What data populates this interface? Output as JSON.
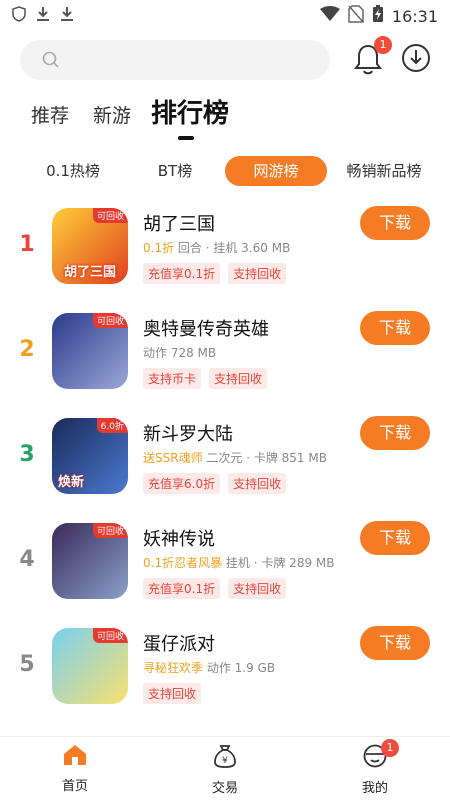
{
  "status_bar": {
    "time": "16:31"
  },
  "header": {
    "bell_badge": "1"
  },
  "main_tabs": [
    {
      "label": "推荐"
    },
    {
      "label": "新游"
    },
    {
      "label": "排行榜"
    }
  ],
  "chips": [
    {
      "label": "0.1热榜"
    },
    {
      "label": "BT榜"
    },
    {
      "label": "网游榜"
    },
    {
      "label": "畅销新品榜"
    }
  ],
  "games": [
    {
      "rank": "1",
      "rank_color": "#e8453c",
      "name": "胡了三国",
      "meta_highlight": "0.1折",
      "meta_rest": "回合 · 挂机 3.60 MB",
      "tags": [
        "充值享0.1折",
        "支持回收"
      ],
      "icon_corner": "可回收",
      "icon_art_text": "胡了三国",
      "icon_colors": [
        "#ffcf3a",
        "#e04020"
      ],
      "download_label": "下载"
    },
    {
      "rank": "2",
      "rank_color": "#f0a020",
      "name": "奥特曼传奇英雄",
      "meta_highlight": "",
      "meta_rest": "动作 728 MB",
      "tags": [
        "支持币卡",
        "支持回收"
      ],
      "icon_corner": "可回收",
      "icon_art_text": "",
      "icon_colors": [
        "#2a3a8a",
        "#9aa8d8"
      ],
      "download_label": "下载"
    },
    {
      "rank": "3",
      "rank_color": "#2aa06a",
      "name": "新斗罗大陆",
      "meta_highlight": "送SSR魂师",
      "meta_rest": "二次元 · 卡牌 851 MB",
      "tags": [
        "充值享6.0折",
        "支持回收"
      ],
      "icon_corner": "6.0折",
      "icon_art_text": "焕新",
      "icon_colors": [
        "#1a2a5a",
        "#4a7ad0"
      ],
      "download_label": "下载"
    },
    {
      "rank": "4",
      "rank_color": "#888888",
      "name": "妖神传说",
      "meta_highlight": "0.1折忍者风暴",
      "meta_rest": "挂机 · 卡牌 289 MB",
      "tags": [
        "充值享0.1折",
        "支持回收"
      ],
      "icon_corner": "可回收",
      "icon_art_text": "",
      "icon_colors": [
        "#3a2a5a",
        "#8aa0c8"
      ],
      "download_label": "下载"
    },
    {
      "rank": "5",
      "rank_color": "#888888",
      "name": "蛋仔派对",
      "meta_highlight": "寻秘狂欢季",
      "meta_rest": "动作 1.9 GB",
      "tags": [
        "支持回收"
      ],
      "icon_corner": "可回收",
      "icon_art_text": "",
      "icon_colors": [
        "#7ad0f0",
        "#f8e070"
      ],
      "download_label": "下载"
    }
  ],
  "bottom_nav": [
    {
      "label": "首页",
      "icon": "home-icon"
    },
    {
      "label": "交易",
      "icon": "money-bag-icon"
    },
    {
      "label": "我的",
      "icon": "profile-icon",
      "badge": "1"
    }
  ],
  "colors": {
    "accent": "#f57b25",
    "tag_text": "#e8453c",
    "badge": "#f04b3b"
  }
}
